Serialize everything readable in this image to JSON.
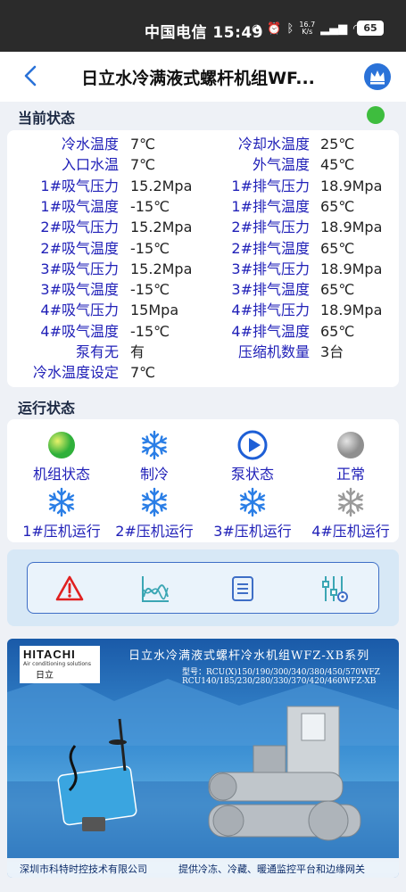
{
  "statusbar": {
    "carrier_time": "中国电信 15:49",
    "net_speed_top": "16.7",
    "net_speed_bottom": "K/s",
    "battery": "65"
  },
  "appbar": {
    "title": "日立水冷满液式螺杆机组WF..."
  },
  "current_status": {
    "title": "当前状态",
    "indicator_color": "#3ebd3e",
    "left": [
      {
        "label": "冷水温度",
        "value": "7℃"
      },
      {
        "label": "入口水温",
        "value": "7℃"
      },
      {
        "label": "1#吸气压力",
        "value": "15.2Mpa"
      },
      {
        "label": "1#吸气温度",
        "value": "-15℃"
      },
      {
        "label": "2#吸气压力",
        "value": "15.2Mpa"
      },
      {
        "label": "2#吸气温度",
        "value": "-15℃"
      },
      {
        "label": "3#吸气压力",
        "value": "15.2Mpa"
      },
      {
        "label": "3#吸气温度",
        "value": "-15℃"
      },
      {
        "label": "4#吸气压力",
        "value": "15Mpa"
      },
      {
        "label": "4#吸气温度",
        "value": "-15℃"
      },
      {
        "label": "泵有无",
        "value": "有"
      },
      {
        "label": "冷水温度设定",
        "value": "7℃"
      }
    ],
    "right": [
      {
        "label": "冷却水温度",
        "value": "25℃"
      },
      {
        "label": "外气温度",
        "value": "45℃"
      },
      {
        "label": "1#排气压力",
        "value": "18.9Mpa"
      },
      {
        "label": "1#排气温度",
        "value": "65℃"
      },
      {
        "label": "2#排气压力",
        "value": "18.9Mpa"
      },
      {
        "label": "2#排气温度",
        "value": "65℃"
      },
      {
        "label": "3#排气压力",
        "value": "18.9Mpa"
      },
      {
        "label": "3#排气温度",
        "value": "65℃"
      },
      {
        "label": "4#排气压力",
        "value": "18.9Mpa"
      },
      {
        "label": "4#排气温度",
        "value": "65℃"
      },
      {
        "label": "压缩机数量",
        "value": "3台"
      }
    ]
  },
  "run_status": {
    "title": "运行状态",
    "items": [
      {
        "label": "机组状态",
        "icon": "green-orb-icon"
      },
      {
        "label": "制冷",
        "icon": "snowflake-icon"
      },
      {
        "label": "泵状态",
        "icon": "play-circle-icon"
      },
      {
        "label": "正常",
        "icon": "gray-orb-icon"
      },
      {
        "label": "1#压机运行",
        "icon": "snowflake-icon"
      },
      {
        "label": "2#压机运行",
        "icon": "snowflake-icon"
      },
      {
        "label": "3#压机运行",
        "icon": "snowflake-icon"
      },
      {
        "label": "4#压机运行",
        "icon": "snowflake-gray-icon"
      }
    ]
  },
  "toolbar": {
    "icons": [
      "alarm-icon",
      "chart-icon",
      "list-icon",
      "settings-icon"
    ]
  },
  "banner": {
    "brand": "HITACHI",
    "brand_sub": "Air conditioning solutions",
    "brand_cn": "日立",
    "title": "日立水冷满液式螺杆冷水机组WFZ-XB系列",
    "models_1": "型号：RCU(X)150/190/300/340/380/450/570WFZ",
    "models_2": "RCU140/185/230/280/330/370/420/460WFZ-XB",
    "footer_left": "深圳市科特时控技术有限公司",
    "footer_right": "提供冷冻、冷藏、暖通监控平台和边缘网关"
  }
}
